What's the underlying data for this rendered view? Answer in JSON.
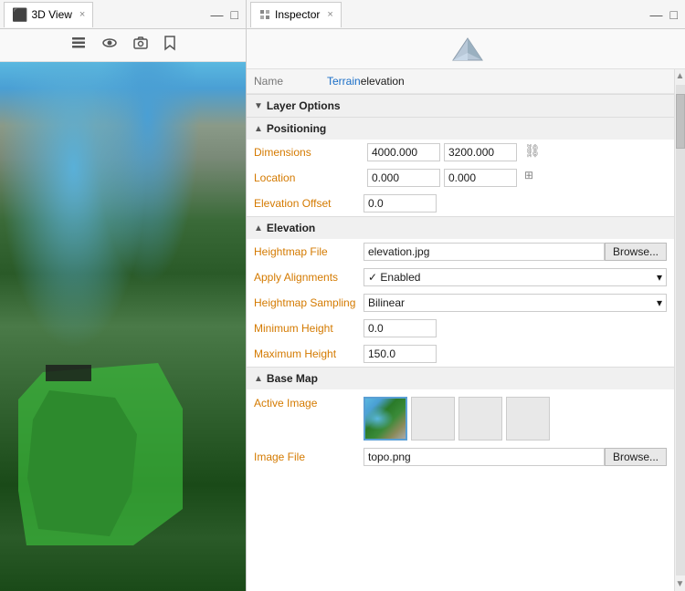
{
  "leftPanel": {
    "title": "3D View",
    "tabClose": "×"
  },
  "rightPanel": {
    "title": "Inspector",
    "tabClose": "×",
    "windowControls": {
      "minimize": "—",
      "maximize": "□"
    }
  },
  "inspector": {
    "nameLabel": "Name",
    "nameValue": "Terrain elevation",
    "layerOptions": "Layer Options",
    "sections": {
      "positioning": {
        "title": "Positioning",
        "fields": {
          "dimensions": {
            "label": "Dimensions",
            "value1": "4000.000",
            "value2": "3200.000"
          },
          "location": {
            "label": "Location",
            "value1": "0.000",
            "value2": "0.000"
          },
          "elevationOffset": {
            "label": "Elevation Offset",
            "value": "0.0"
          }
        }
      },
      "elevation": {
        "title": "Elevation",
        "fields": {
          "heightmapFile": {
            "label": "Heightmap File",
            "value": "elevation.jpg",
            "browseLabel": "Browse..."
          },
          "applyAlignments": {
            "label": "Apply Alignments",
            "value": "✓ Enabled"
          },
          "heightmapSampling": {
            "label": "Heightmap Sampling",
            "value": "Bilinear"
          },
          "minimumHeight": {
            "label": "Minimum Height",
            "value": "0.0"
          },
          "maximumHeight": {
            "label": "Maximum Height",
            "value": "150.0"
          }
        }
      },
      "baseMap": {
        "title": "Base Map",
        "fields": {
          "activeImage": {
            "label": "Active Image"
          },
          "imageFile": {
            "label": "Image File",
            "value": "topo.png",
            "browseLabel": "Browse..."
          }
        }
      }
    }
  }
}
